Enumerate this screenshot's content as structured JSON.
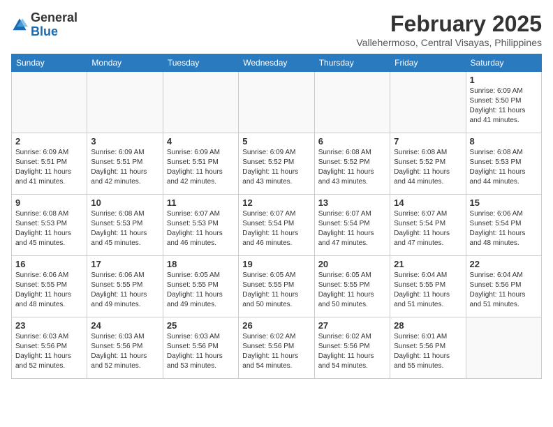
{
  "header": {
    "logo_general": "General",
    "logo_blue": "Blue",
    "month_year": "February 2025",
    "location": "Vallehermoso, Central Visayas, Philippines"
  },
  "weekdays": [
    "Sunday",
    "Monday",
    "Tuesday",
    "Wednesday",
    "Thursday",
    "Friday",
    "Saturday"
  ],
  "weeks": [
    [
      {
        "day": "",
        "info": ""
      },
      {
        "day": "",
        "info": ""
      },
      {
        "day": "",
        "info": ""
      },
      {
        "day": "",
        "info": ""
      },
      {
        "day": "",
        "info": ""
      },
      {
        "day": "",
        "info": ""
      },
      {
        "day": "1",
        "info": "Sunrise: 6:09 AM\nSunset: 5:50 PM\nDaylight: 11 hours\nand 41 minutes."
      }
    ],
    [
      {
        "day": "2",
        "info": "Sunrise: 6:09 AM\nSunset: 5:51 PM\nDaylight: 11 hours\nand 41 minutes."
      },
      {
        "day": "3",
        "info": "Sunrise: 6:09 AM\nSunset: 5:51 PM\nDaylight: 11 hours\nand 42 minutes."
      },
      {
        "day": "4",
        "info": "Sunrise: 6:09 AM\nSunset: 5:51 PM\nDaylight: 11 hours\nand 42 minutes."
      },
      {
        "day": "5",
        "info": "Sunrise: 6:09 AM\nSunset: 5:52 PM\nDaylight: 11 hours\nand 43 minutes."
      },
      {
        "day": "6",
        "info": "Sunrise: 6:08 AM\nSunset: 5:52 PM\nDaylight: 11 hours\nand 43 minutes."
      },
      {
        "day": "7",
        "info": "Sunrise: 6:08 AM\nSunset: 5:52 PM\nDaylight: 11 hours\nand 44 minutes."
      },
      {
        "day": "8",
        "info": "Sunrise: 6:08 AM\nSunset: 5:53 PM\nDaylight: 11 hours\nand 44 minutes."
      }
    ],
    [
      {
        "day": "9",
        "info": "Sunrise: 6:08 AM\nSunset: 5:53 PM\nDaylight: 11 hours\nand 45 minutes."
      },
      {
        "day": "10",
        "info": "Sunrise: 6:08 AM\nSunset: 5:53 PM\nDaylight: 11 hours\nand 45 minutes."
      },
      {
        "day": "11",
        "info": "Sunrise: 6:07 AM\nSunset: 5:53 PM\nDaylight: 11 hours\nand 46 minutes."
      },
      {
        "day": "12",
        "info": "Sunrise: 6:07 AM\nSunset: 5:54 PM\nDaylight: 11 hours\nand 46 minutes."
      },
      {
        "day": "13",
        "info": "Sunrise: 6:07 AM\nSunset: 5:54 PM\nDaylight: 11 hours\nand 47 minutes."
      },
      {
        "day": "14",
        "info": "Sunrise: 6:07 AM\nSunset: 5:54 PM\nDaylight: 11 hours\nand 47 minutes."
      },
      {
        "day": "15",
        "info": "Sunrise: 6:06 AM\nSunset: 5:54 PM\nDaylight: 11 hours\nand 48 minutes."
      }
    ],
    [
      {
        "day": "16",
        "info": "Sunrise: 6:06 AM\nSunset: 5:55 PM\nDaylight: 11 hours\nand 48 minutes."
      },
      {
        "day": "17",
        "info": "Sunrise: 6:06 AM\nSunset: 5:55 PM\nDaylight: 11 hours\nand 49 minutes."
      },
      {
        "day": "18",
        "info": "Sunrise: 6:05 AM\nSunset: 5:55 PM\nDaylight: 11 hours\nand 49 minutes."
      },
      {
        "day": "19",
        "info": "Sunrise: 6:05 AM\nSunset: 5:55 PM\nDaylight: 11 hours\nand 50 minutes."
      },
      {
        "day": "20",
        "info": "Sunrise: 6:05 AM\nSunset: 5:55 PM\nDaylight: 11 hours\nand 50 minutes."
      },
      {
        "day": "21",
        "info": "Sunrise: 6:04 AM\nSunset: 5:55 PM\nDaylight: 11 hours\nand 51 minutes."
      },
      {
        "day": "22",
        "info": "Sunrise: 6:04 AM\nSunset: 5:56 PM\nDaylight: 11 hours\nand 51 minutes."
      }
    ],
    [
      {
        "day": "23",
        "info": "Sunrise: 6:03 AM\nSunset: 5:56 PM\nDaylight: 11 hours\nand 52 minutes."
      },
      {
        "day": "24",
        "info": "Sunrise: 6:03 AM\nSunset: 5:56 PM\nDaylight: 11 hours\nand 52 minutes."
      },
      {
        "day": "25",
        "info": "Sunrise: 6:03 AM\nSunset: 5:56 PM\nDaylight: 11 hours\nand 53 minutes."
      },
      {
        "day": "26",
        "info": "Sunrise: 6:02 AM\nSunset: 5:56 PM\nDaylight: 11 hours\nand 54 minutes."
      },
      {
        "day": "27",
        "info": "Sunrise: 6:02 AM\nSunset: 5:56 PM\nDaylight: 11 hours\nand 54 minutes."
      },
      {
        "day": "28",
        "info": "Sunrise: 6:01 AM\nSunset: 5:56 PM\nDaylight: 11 hours\nand 55 minutes."
      },
      {
        "day": "",
        "info": ""
      }
    ]
  ]
}
